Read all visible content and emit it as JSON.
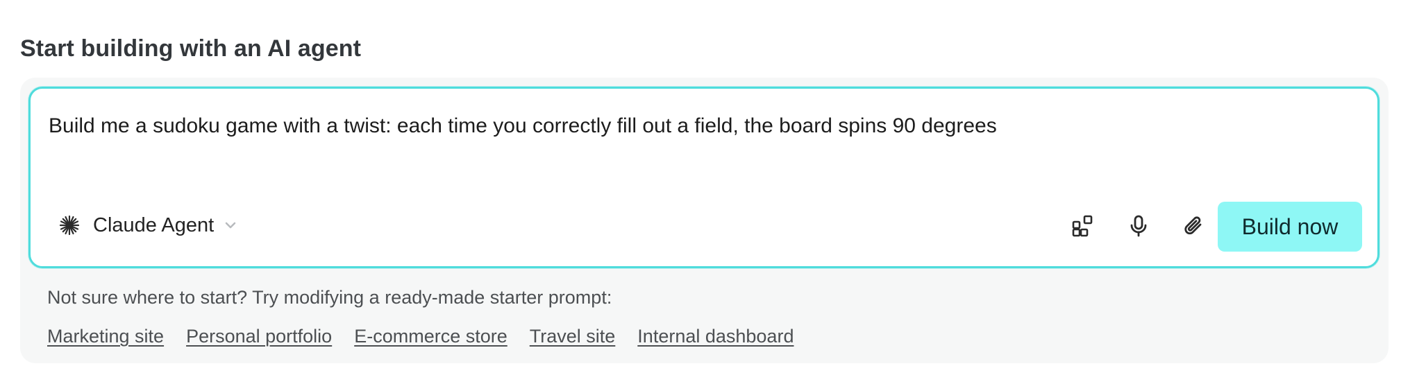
{
  "heading": "Start building with an AI agent",
  "prompt": {
    "text": "Build me a sudoku game with a twist: each time you correctly fill out a field, the board spins 90 degrees"
  },
  "model_selector": {
    "icon": "claude-spark-icon",
    "label": "Claude Agent",
    "chevron": "chevron-down-icon"
  },
  "toolbar": {
    "integrations_icon": "apps-grid-icon",
    "voice_icon": "microphone-icon",
    "attach_icon": "paperclip-icon",
    "build_label": "Build now"
  },
  "starter": {
    "hint": "Not sure where to start? Try modifying a ready-made starter prompt:",
    "links": [
      "Marketing site",
      "Personal portfolio",
      "E-commerce store",
      "Travel site",
      "Internal dashboard"
    ]
  },
  "colors": {
    "accent_border": "#4fdcdc",
    "build_button": "#8ef7f5",
    "panel_bg": "#f6f7f7"
  }
}
